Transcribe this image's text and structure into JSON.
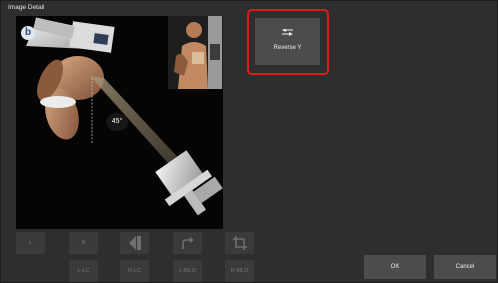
{
  "window": {
    "title": "Image Detail"
  },
  "viewer": {
    "angle_label": "45°",
    "logo_glyph": "b"
  },
  "toolbar": {
    "row1": [
      {
        "name": "tool-l",
        "label": "L"
      },
      {
        "name": "tool-r",
        "label": "R"
      },
      {
        "name": "tool-shutter",
        "icon": "shutter-icon"
      },
      {
        "name": "tool-rotate",
        "icon": "rotate-arrow-icon"
      },
      {
        "name": "tool-crop",
        "icon": "crop-icon"
      }
    ],
    "row2": [
      {
        "name": "tool-l-lc",
        "label": "L-LC"
      },
      {
        "name": "tool-r-lc",
        "label": "R-LC"
      },
      {
        "name": "tool-l-mlo",
        "label": "L-MLO"
      },
      {
        "name": "tool-r-mlo",
        "label": "R-MLO"
      }
    ]
  },
  "reverse_y": {
    "label": "Reverse Y",
    "icon": "reverse-y-icon",
    "highlight_color": "#e01a1a"
  },
  "actions": {
    "ok_label": "OK",
    "cancel_label": "Cancel"
  }
}
